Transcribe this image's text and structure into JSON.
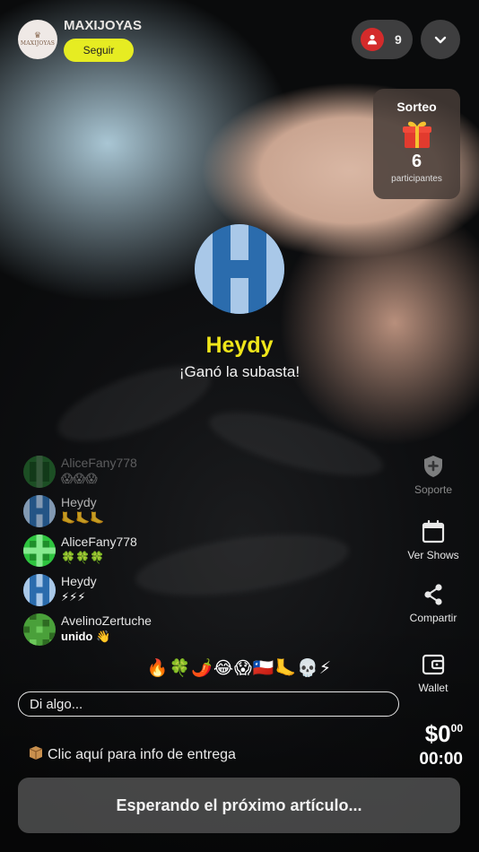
{
  "host": {
    "name": "MAXIJOYAS",
    "logo_text": "MAXIJOYAS",
    "follow_label": "Seguir"
  },
  "viewers": {
    "count": "9",
    "icon": "person-icon"
  },
  "raffle": {
    "title": "Sorteo",
    "icon": "gift-icon",
    "count": "6",
    "label": "participantes"
  },
  "winner": {
    "name": "Heydy",
    "message": "¡Ganó la subasta!"
  },
  "chat": [
    {
      "user": "AliceFany778",
      "message": "😱😱😱"
    },
    {
      "user": "Heydy",
      "message": "🦶🦶🦶"
    },
    {
      "user": "AliceFany778",
      "message": "🍀🍀🍀"
    },
    {
      "user": "Heydy",
      "message": "⚡⚡⚡"
    },
    {
      "user": "AvelinoZertuche",
      "message": "unido 👋"
    }
  ],
  "side_actions": [
    {
      "label": "Soporte",
      "icon": "shield-plus-icon"
    },
    {
      "label": "Ver Shows",
      "icon": "calendar-icon"
    },
    {
      "label": "Compartir",
      "icon": "share-icon"
    },
    {
      "label": "Wallet",
      "icon": "wallet-icon"
    }
  ],
  "reactions": "🔥🍀🌶️😂😱🇨🇱🦶💀⚡",
  "input": {
    "placeholder": "Di algo..."
  },
  "delivery": {
    "icon": "package-icon",
    "text": "Clic aquí para info de entrega"
  },
  "price": {
    "main": "$0",
    "cents": "00"
  },
  "timer": "00:00",
  "status_button": "Esperando el próximo artículo...",
  "colors": {
    "follow_button": "#e6ec22",
    "winner_name": "#f0e61a",
    "viewer_badge": "#d42b2b"
  }
}
